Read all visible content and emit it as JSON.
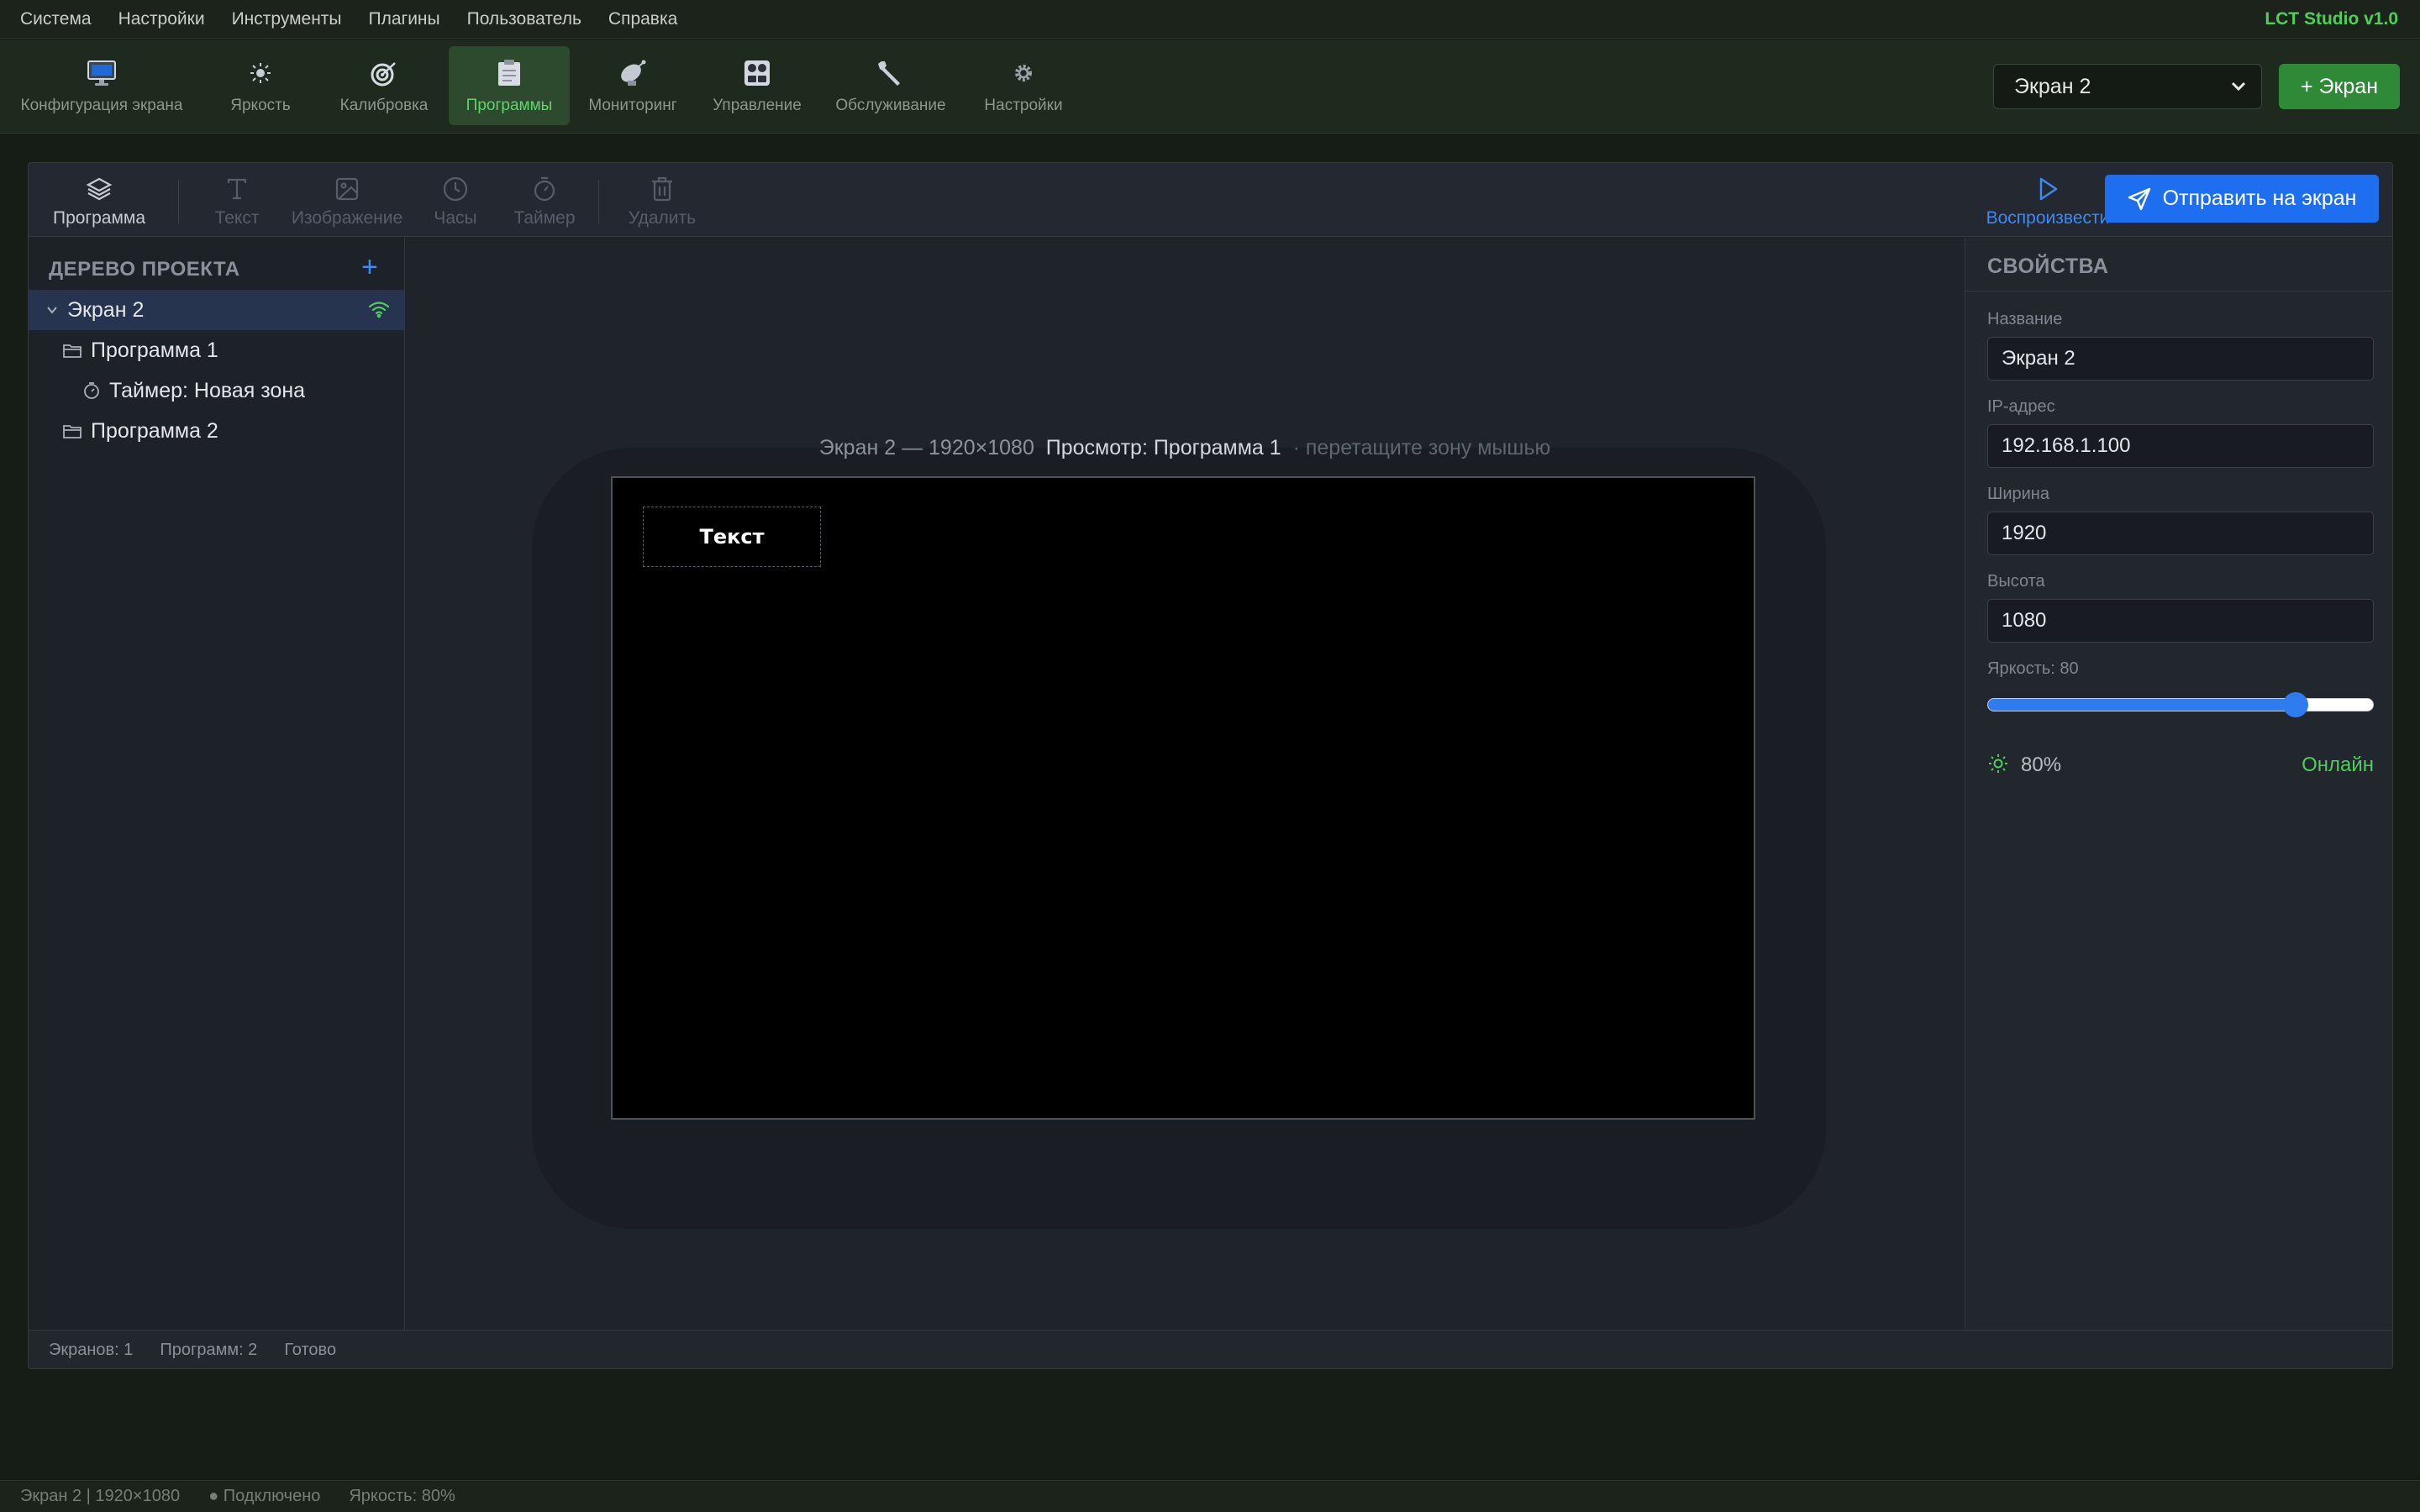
{
  "menu": {
    "items": [
      "Система",
      "Настройки",
      "Инструменты",
      "Плагины",
      "Пользователь",
      "Справка"
    ],
    "brand": "LCT Studio v1.0"
  },
  "toolbar": {
    "items": [
      {
        "label": "Конфигурация экрана",
        "icon": "monitor-icon"
      },
      {
        "label": "Яркость",
        "icon": "sun-icon"
      },
      {
        "label": "Калибровка",
        "icon": "target-icon"
      },
      {
        "label": "Программы",
        "icon": "clipboard-icon"
      },
      {
        "label": "Мониторинг",
        "icon": "satellite-icon"
      },
      {
        "label": "Управление",
        "icon": "control-panel-icon"
      },
      {
        "label": "Обслуживание",
        "icon": "wrench-icon"
      },
      {
        "label": "Настройки",
        "icon": "gear-icon"
      }
    ],
    "active": "Программы",
    "screen_select": "Экран 2",
    "add_screen": "+ Экран"
  },
  "subbar": {
    "program": "Программа",
    "text": "Текст",
    "image": "Изображение",
    "clock": "Часы",
    "timer": "Таймер",
    "delete": "Удалить",
    "play": "Воспроизвести",
    "send": "Отправить на экран"
  },
  "tree": {
    "title": "ДЕРЕВО ПРОЕКТА",
    "add": "+",
    "screen": "Экран 2",
    "program1": "Программа 1",
    "timer_zone": "Таймер: Новая зона",
    "program2": "Программа 2"
  },
  "canvas": {
    "caption_dim": "Экран 2 — 1920×1080",
    "caption_preview": "Просмотр: Программа 1",
    "caption_hint": "· перетащите зону мышью",
    "zone_text": "Текст"
  },
  "properties": {
    "title": "СВОЙСТВА",
    "name_label": "Название",
    "name_value": "Экран 2",
    "ip_label": "IP-адрес",
    "ip_value": "192.168.1.100",
    "width_label": "Ширина",
    "width_value": "1920",
    "height_label": "Высота",
    "height_value": "1080",
    "brightness_label": "Яркость: 80",
    "brightness_value": 80,
    "brightness_percent": "80%",
    "status": "Онлайн"
  },
  "frame_status": {
    "screens": "Экранов: 1",
    "programs": "Программ: 2",
    "state": "Готово"
  },
  "app_status": {
    "screen": "Экран 2 | 1920×1080",
    "connection": "● Подключено",
    "brightness": "Яркость: 80%"
  },
  "colors": {
    "accent_green": "#4fcf5a",
    "accent_blue": "#1e6ef0",
    "active_tab_bg": "#2e4a2e"
  }
}
